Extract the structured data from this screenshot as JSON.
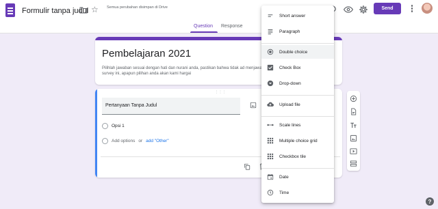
{
  "header": {
    "doc_title": "Formulir tanpa judul",
    "save_status": "Semua perubahan disimpan di Drive",
    "send_label": "Send",
    "tabs": [
      {
        "label": "Question",
        "active": true
      },
      {
        "label": "Response",
        "active": false
      }
    ]
  },
  "form": {
    "title": "Pembelajaran 2021",
    "description": "Pilihlah jawaban sesuai dengan hati dan nurani anda, pastikan bahwa tidak ad menjawab survey ini, apapun pilihan anda akan kami hargai"
  },
  "question": {
    "placeholder": "Pertanyaan Tanpa Judul",
    "options": [
      {
        "label": "Opsi 1"
      }
    ],
    "add_option_label": "Add options",
    "or_label": "or",
    "add_other_label": "add \"Other\""
  },
  "question_type_menu": {
    "items": [
      {
        "label": "Short answer",
        "icon": "short-answer-icon",
        "selected": false
      },
      {
        "label": "Paragraph",
        "icon": "paragraph-icon",
        "selected": false
      },
      {
        "label": "Double choice",
        "icon": "radio-button-icon",
        "selected": true
      },
      {
        "label": "Check Box",
        "icon": "checkbox-icon",
        "selected": false
      },
      {
        "label": "Drop-down",
        "icon": "dropdown-icon",
        "selected": false
      },
      {
        "label": "Upload file",
        "icon": "upload-icon",
        "selected": false
      },
      {
        "label": "Scale lines",
        "icon": "linear-scale-icon",
        "selected": false
      },
      {
        "label": "Multiple choice grid",
        "icon": "grid-icon",
        "selected": false
      },
      {
        "label": "Checkbox tile",
        "icon": "checkbox-grid-icon",
        "selected": false
      },
      {
        "label": "Date",
        "icon": "calendar-icon",
        "selected": false
      },
      {
        "label": "Time",
        "icon": "clock-icon",
        "selected": false
      }
    ]
  },
  "side_toolbar": {
    "icons": [
      "add-question-icon",
      "import-questions-icon",
      "add-title-icon",
      "add-image-icon",
      "add-video-icon",
      "add-section-icon"
    ]
  },
  "colors": {
    "accent": "#673ab7",
    "background": "#f0ebf8",
    "active_border": "#4285f4",
    "link": "#1a73e8"
  }
}
